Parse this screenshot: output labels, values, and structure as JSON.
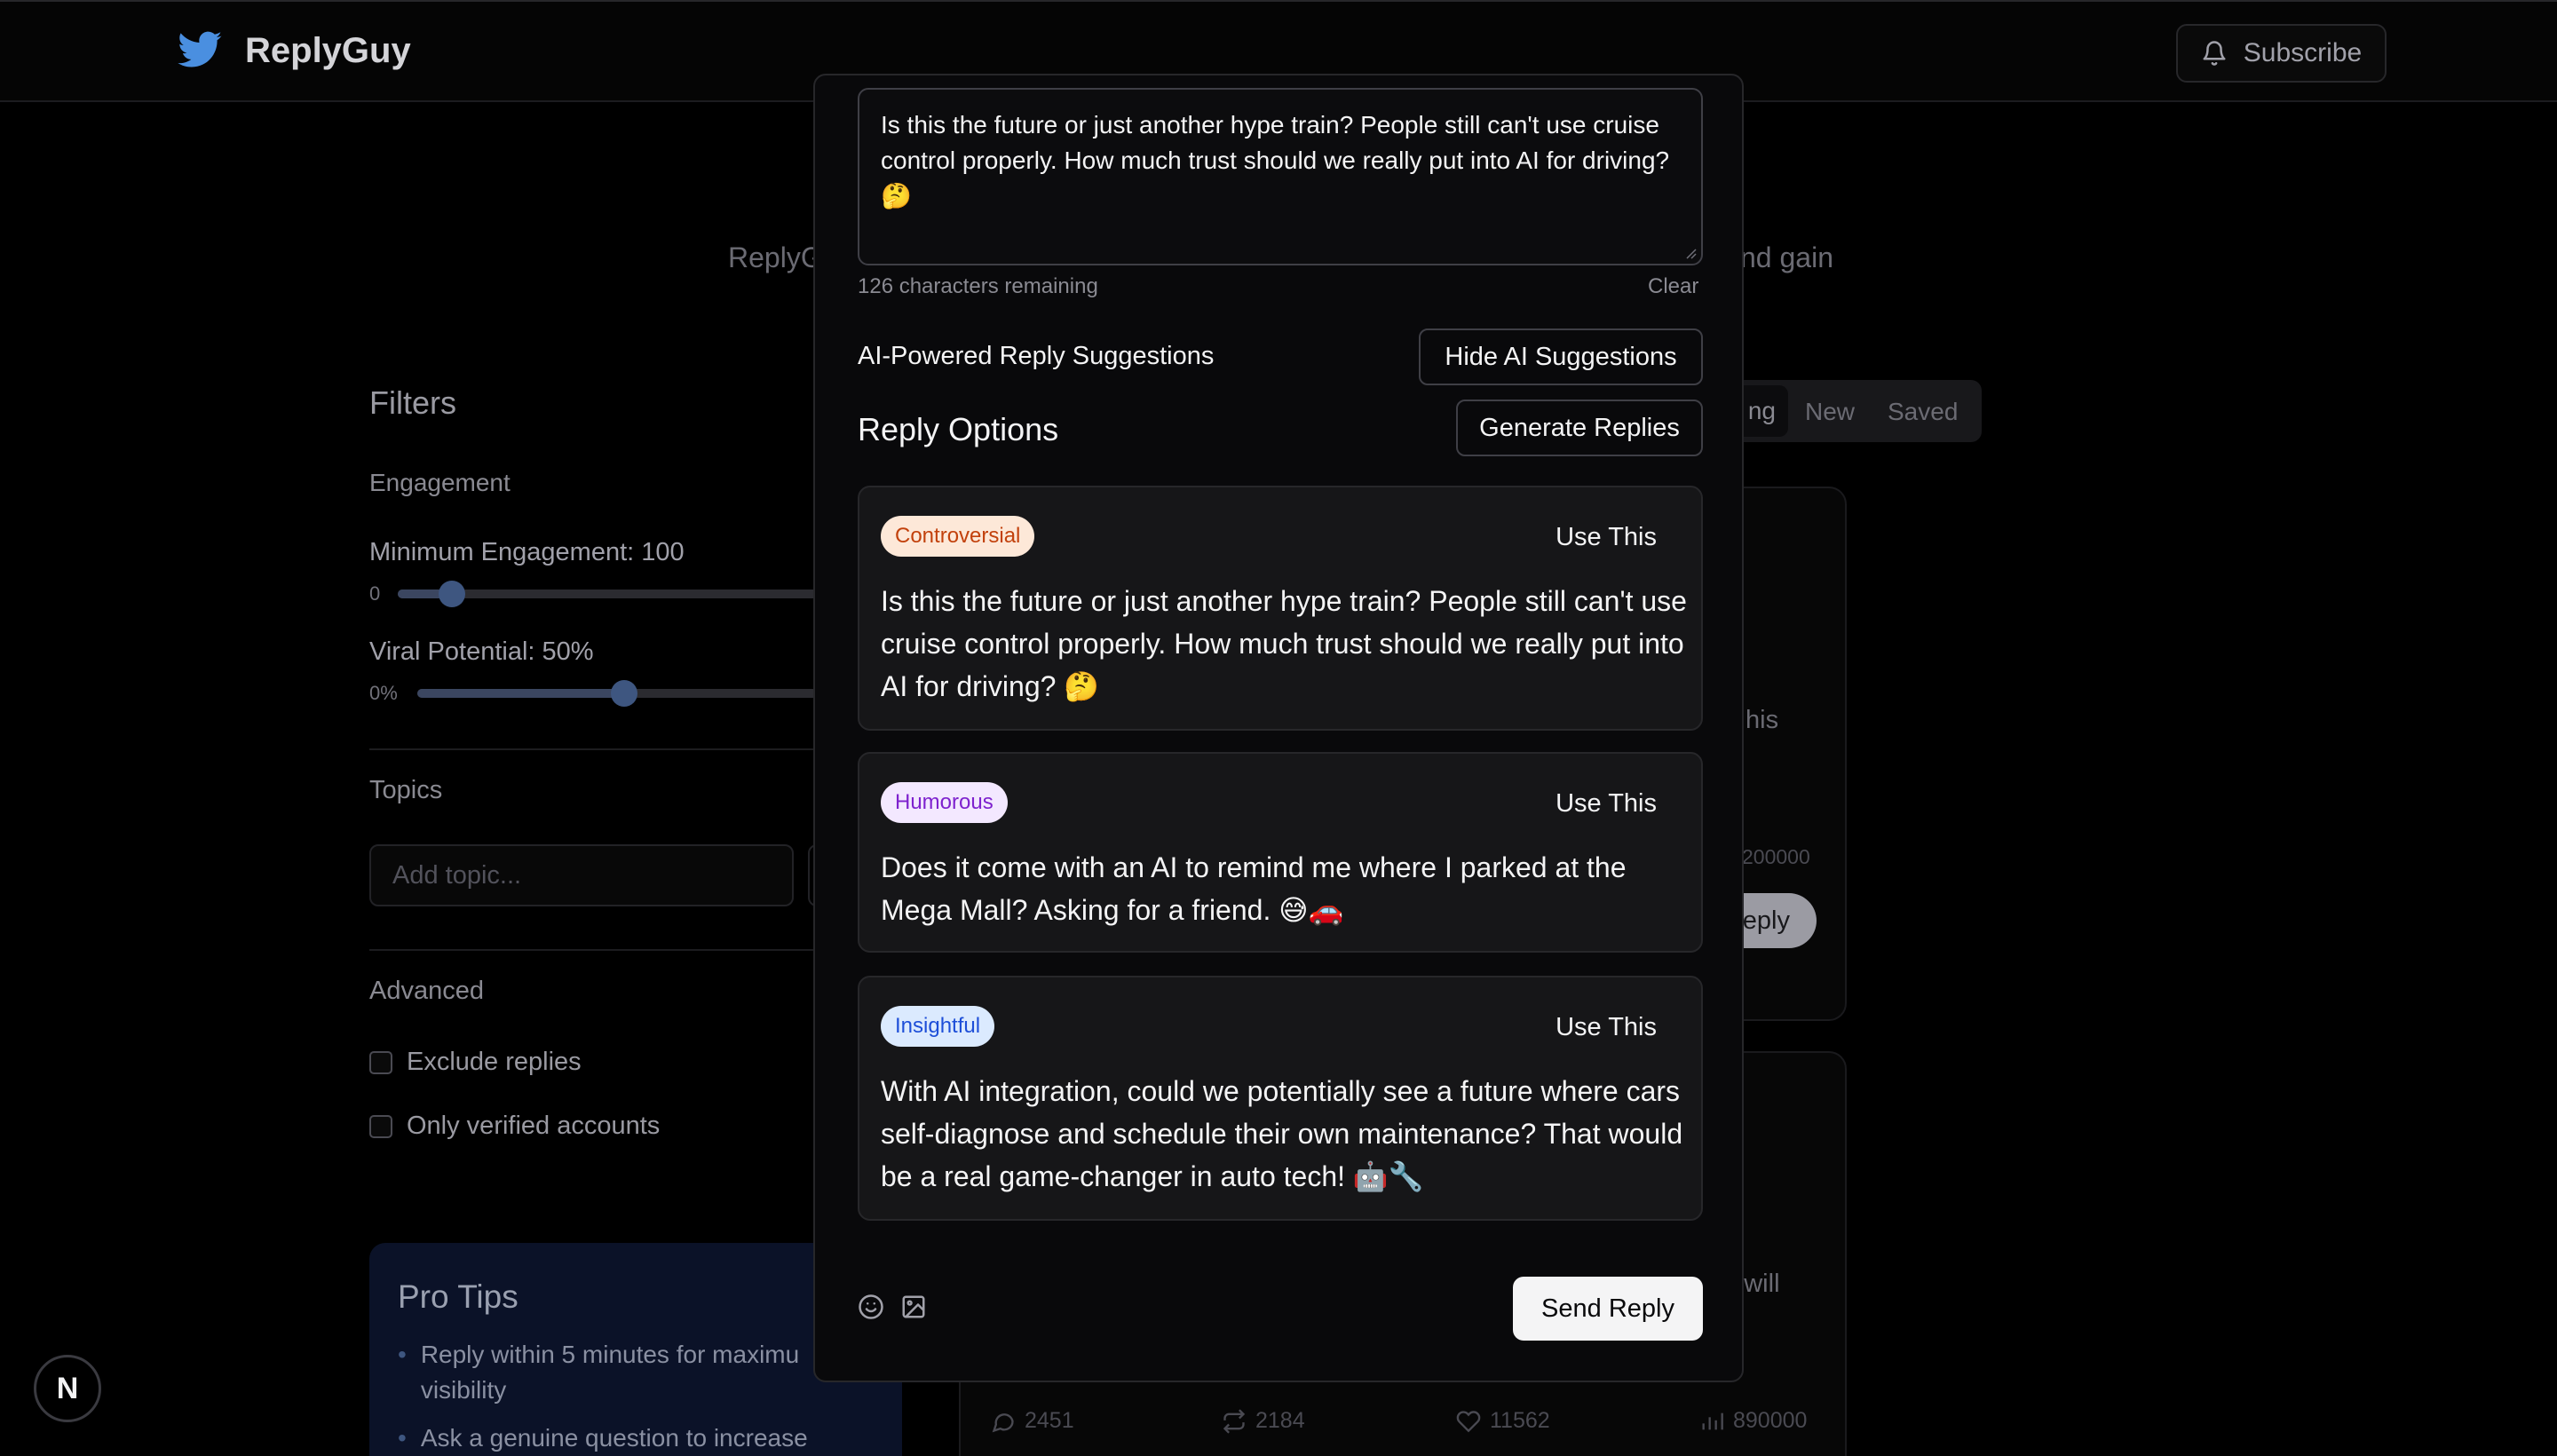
{
  "header": {
    "brand": "ReplyGuy",
    "subscribe_label": "Subscribe"
  },
  "background": {
    "subtitle_left": "ReplyG",
    "subtitle_right": "nd gain",
    "filters": {
      "title": "Filters",
      "engagement_section": "Engagement",
      "min_engagement_label": "Minimum Engagement: 100",
      "min_engagement_min": "0",
      "min_engagement_value": 100,
      "viral_label": "Viral Potential: 50%",
      "viral_min": "0%",
      "viral_value_fraction": 0.5,
      "topics_label": "Topics",
      "topic_placeholder": "Add topic...",
      "advanced_label": "Advanced",
      "checkboxes": [
        {
          "label": "Exclude replies",
          "checked": false
        },
        {
          "label": "Only verified accounts",
          "checked": false
        }
      ]
    },
    "pro_tips": {
      "title": "Pro Tips",
      "items": [
        "Reply within 5 minutes for maximu visibility",
        "Ask a genuine question to increase"
      ]
    },
    "tabs": [
      "ng",
      "New",
      "Saved"
    ],
    "card1": {
      "fragment": "his",
      "number": "200000",
      "reply_fragment": "eply"
    },
    "card2": {
      "fragment": "at will",
      "stats": {
        "comments": "2451",
        "retweets": "2184",
        "likes": "11562",
        "views": "890000"
      }
    },
    "badge_letter": "N"
  },
  "modal": {
    "compose_text": "Is this the future or just another hype train? People still can't use cruise control properly. How much trust should we really put into AI for driving? 🤔",
    "remaining": "126 characters remaining",
    "clear_label": "Clear",
    "ai_label": "AI-Powered Reply Suggestions",
    "hide_ai_label": "Hide AI Suggestions",
    "reply_options_title": "Reply Options",
    "generate_label": "Generate Replies",
    "use_label": "Use This",
    "options": [
      {
        "tag": "Controversial",
        "text": "Is this the future or just another hype train? People still can't use cruise control properly. How much trust should we really put into AI for driving? 🤔"
      },
      {
        "tag": "Humorous",
        "text": "Does it come with an AI to remind me where I parked at the Mega Mall? Asking for a friend. 😅🚗"
      },
      {
        "tag": "Insightful",
        "text": "With AI integration, could we potentially see a future where cars self-diagnose and schedule their own maintenance? That would be a real game-changer in auto tech! 🤖🔧"
      }
    ],
    "send_label": "Send Reply"
  },
  "colors": {
    "controversial_bg": "#fde8d8",
    "controversial_fg": "#c2410c",
    "humorous_bg": "#f3e8ff",
    "humorous_fg": "#7e22ce",
    "insightful_bg": "#dbeafe",
    "insightful_fg": "#1d4ed8",
    "twitter_blue": "#3b82f6"
  }
}
